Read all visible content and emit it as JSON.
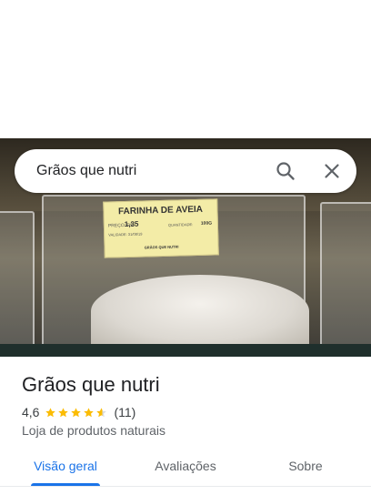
{
  "search": {
    "value": "Grãos que nutri"
  },
  "photo": {
    "label_title": "FARINHA DE AVEIA",
    "label_price_label": "PREÇO: R$",
    "label_price": "1,35",
    "label_validity": "VALIDADE: 31/08/19",
    "label_quantity_label": "QUANTIDADE:",
    "label_quantity": "100G",
    "label_brand": "GRÃOS QUE NUTRI"
  },
  "place": {
    "name": "Grãos que nutri",
    "rating_value": "4,6",
    "rating": 4.6,
    "rating_max": 5,
    "review_count": "(11)",
    "category": "Loja de produtos naturais"
  },
  "tabs": [
    {
      "label": "Visão geral",
      "active": true
    },
    {
      "label": "Avaliações",
      "active": false
    },
    {
      "label": "Sobre",
      "active": false
    }
  ],
  "colors": {
    "accent": "#1a73e8",
    "star": "#fbbc04",
    "star_empty": "#dadce0"
  },
  "icons": {
    "search": "search-icon",
    "close": "close-icon",
    "star": "star-icon"
  }
}
